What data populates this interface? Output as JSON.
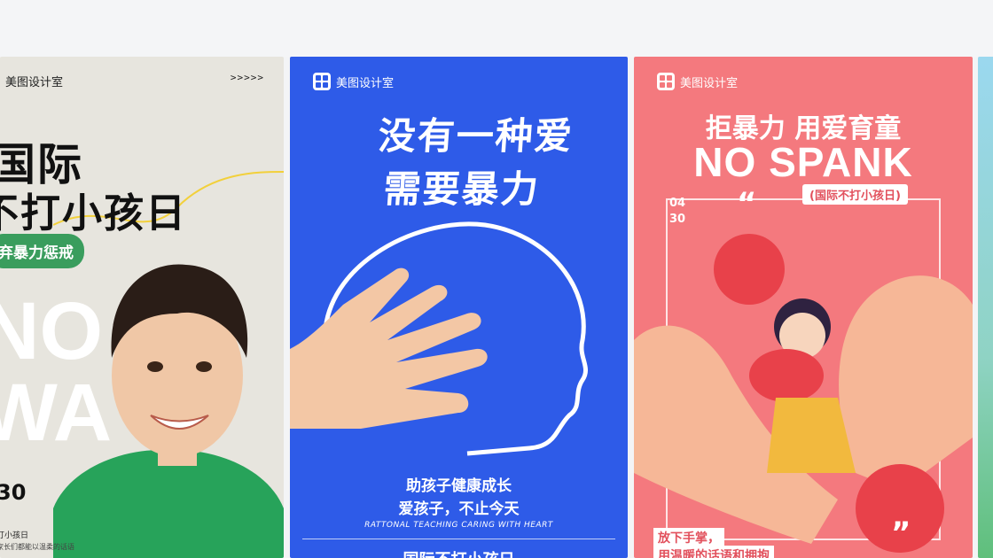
{
  "cards": [
    {
      "brand": "美图设计室",
      "arrows": ">>>>>",
      "title_line1": "国际",
      "title_line2": "不打小孩日",
      "bubble": "弃暴力惩戒",
      "big_line1": "NO",
      "big_line2": "WA",
      "date": "30",
      "small_line1": "打小孩日",
      "small_line2": "家长们都能以温柔的话语"
    },
    {
      "brand": "美图设计室",
      "title_line1": "没有一种爱",
      "title_line2": "需要暴力",
      "sub_line1": "助孩子健康成长",
      "sub_line2": "爱孩子，不止今天",
      "english": "RATTONAL TEACHING CARING WITH HEART",
      "footer": "国际不打小孩日"
    },
    {
      "brand": "美图设计室",
      "title_line1": "拒暴力 用爱育童",
      "title_line2": "NO SPANK",
      "tag": "(国际不打小孩日)",
      "date_month": "04",
      "date_day": "30",
      "quote_open": "“",
      "quote_close": "”",
      "bottom_line1": "放下手掌，",
      "bottom_line2": "用温暖的话语和拥抱"
    }
  ],
  "colors": {
    "card1_bg": "#e7e5de",
    "card1_accent": "#3a9d5d",
    "card2_bg": "#2e5be8",
    "card3_bg": "#f4797e",
    "card3_accent": "#e2505c"
  }
}
